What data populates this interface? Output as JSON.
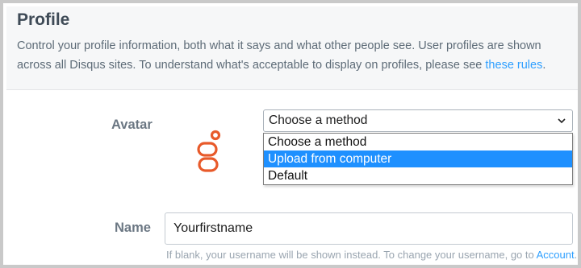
{
  "header": {
    "title": "Profile",
    "description": "Control your profile information, both what it says and what other people see. User profiles are shown across all Disqus sites. To understand what's acceptable to display on profiles, please see ",
    "rules_link": "these rules",
    "description_end": "."
  },
  "avatar": {
    "label": "Avatar",
    "icon": "disqus-avatar-glyph",
    "avatar_color": "#e85a2a",
    "select": {
      "selected": "Choose a method",
      "options": [
        "Choose a method",
        "Upload from computer",
        "Default"
      ],
      "highlighted": "Upload from computer"
    }
  },
  "name": {
    "label": "Name",
    "value": "Yourfirstname",
    "hint": "If blank, your username will be shown instead. To change your username, go to ",
    "account_link": "Account",
    "hint_end": "."
  },
  "colors": {
    "link": "#2e9fff",
    "highlight": "#1e90ff"
  }
}
